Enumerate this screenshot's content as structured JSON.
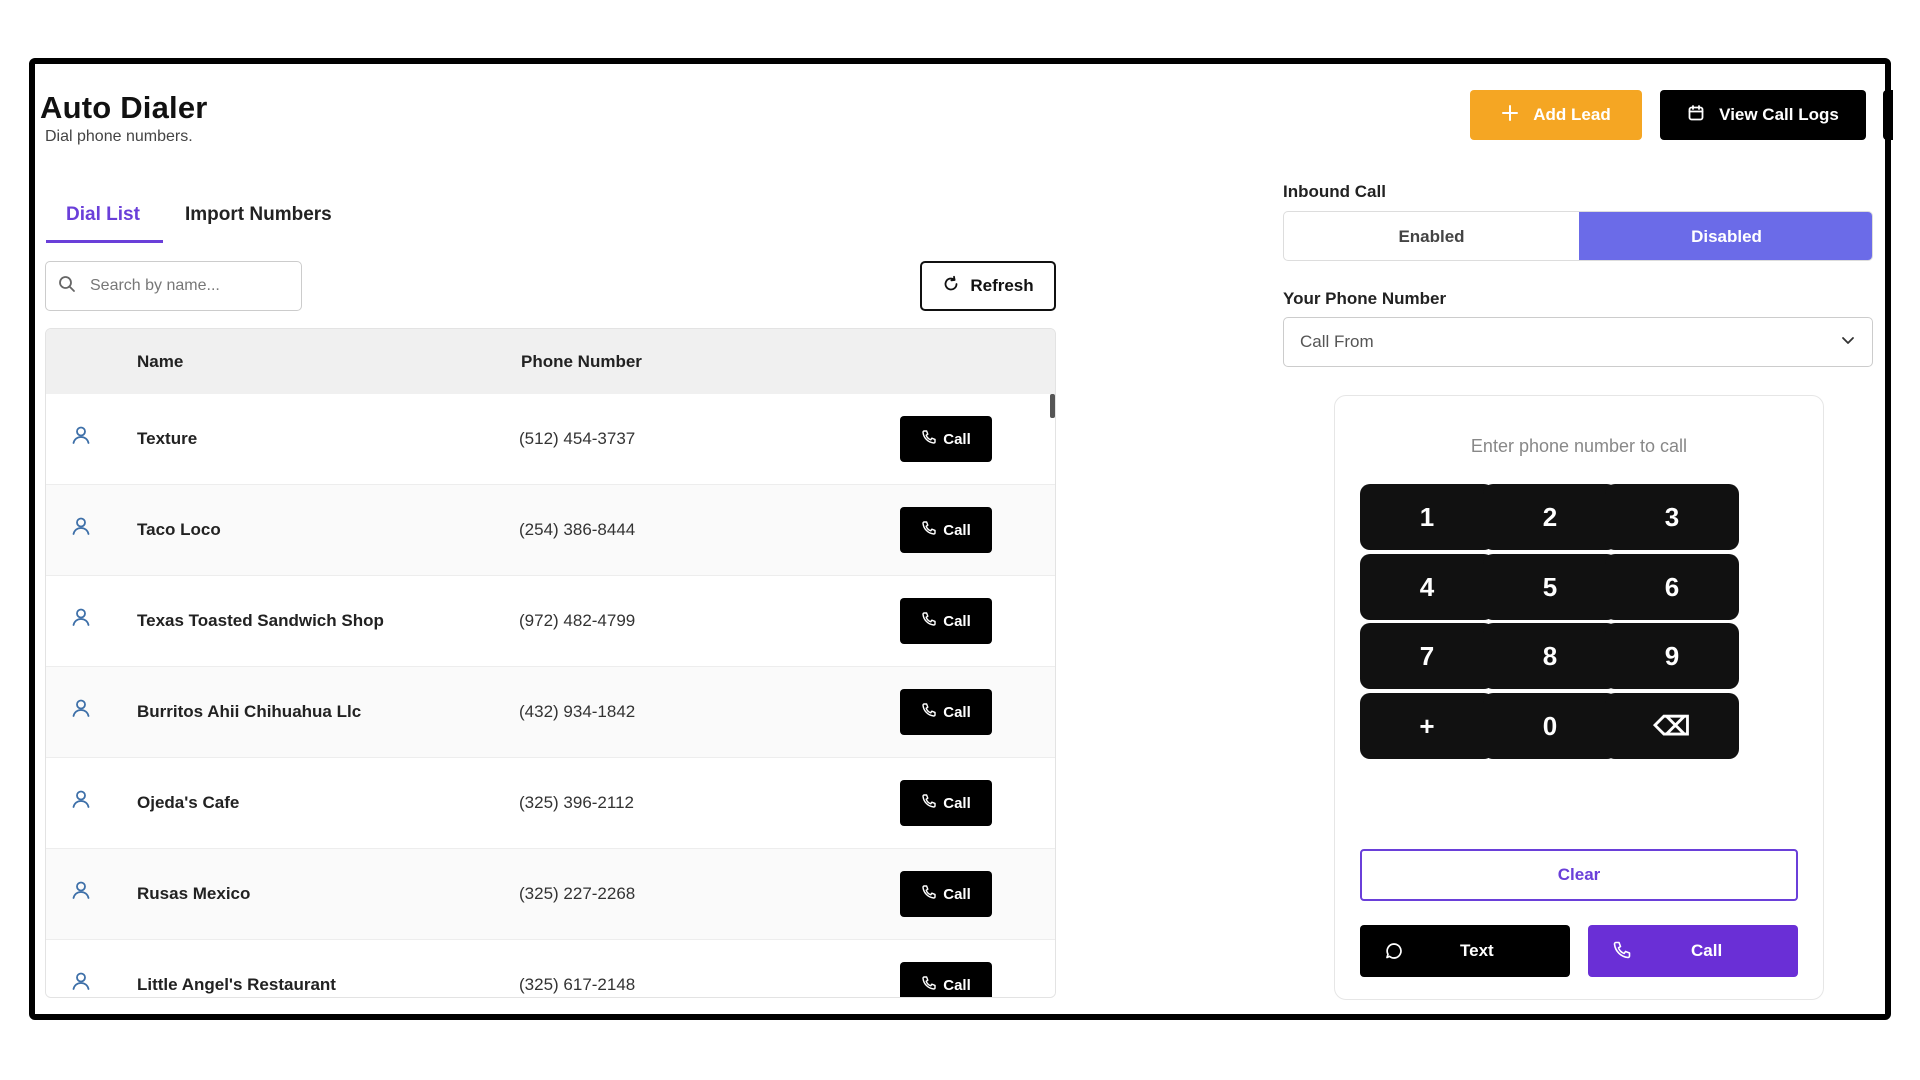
{
  "header": {
    "title": "Auto Dialer",
    "subtitle": "Dial phone numbers.",
    "add_lead_label": "Add Lead",
    "view_logs_label": "View Call Logs"
  },
  "tabs": [
    {
      "label": "Dial List",
      "active": true
    },
    {
      "label": "Import Numbers",
      "active": false
    }
  ],
  "search": {
    "placeholder": "Search by name..."
  },
  "refresh_label": "Refresh",
  "table": {
    "columns": [
      "Name",
      "Phone Number"
    ],
    "call_label": "Call",
    "rows": [
      {
        "name": "Texture",
        "phone": "(512) 454-3737"
      },
      {
        "name": "Taco Loco",
        "phone": "(254) 386-8444"
      },
      {
        "name": "Texas Toasted Sandwich Shop",
        "phone": "(972) 482-4799"
      },
      {
        "name": "Burritos Ahii Chihuahua Llc",
        "phone": "(432) 934-1842"
      },
      {
        "name": "Ojeda's Cafe",
        "phone": "(325) 396-2112"
      },
      {
        "name": "Rusas Mexico",
        "phone": "(325) 227-2268"
      },
      {
        "name": "Little Angel's Restaurant",
        "phone": "(325) 617-2148"
      }
    ]
  },
  "inbound": {
    "label": "Inbound Call",
    "enabled_label": "Enabled",
    "disabled_label": "Disabled",
    "selected": "Disabled"
  },
  "phone_select": {
    "label": "Your Phone Number",
    "value": "Call From"
  },
  "dialer": {
    "placeholder": "Enter phone number to call",
    "keys": [
      "1",
      "2",
      "3",
      "4",
      "5",
      "6",
      "7",
      "8",
      "9",
      "+",
      "0",
      "⌫"
    ],
    "clear_label": "Clear",
    "text_label": "Text",
    "call_label": "Call"
  },
  "colors": {
    "accent": "#6a3fd9",
    "add_lead": "#f5a623",
    "toggle_active": "#6b6be8",
    "call_primary": "#6a2fd6"
  }
}
